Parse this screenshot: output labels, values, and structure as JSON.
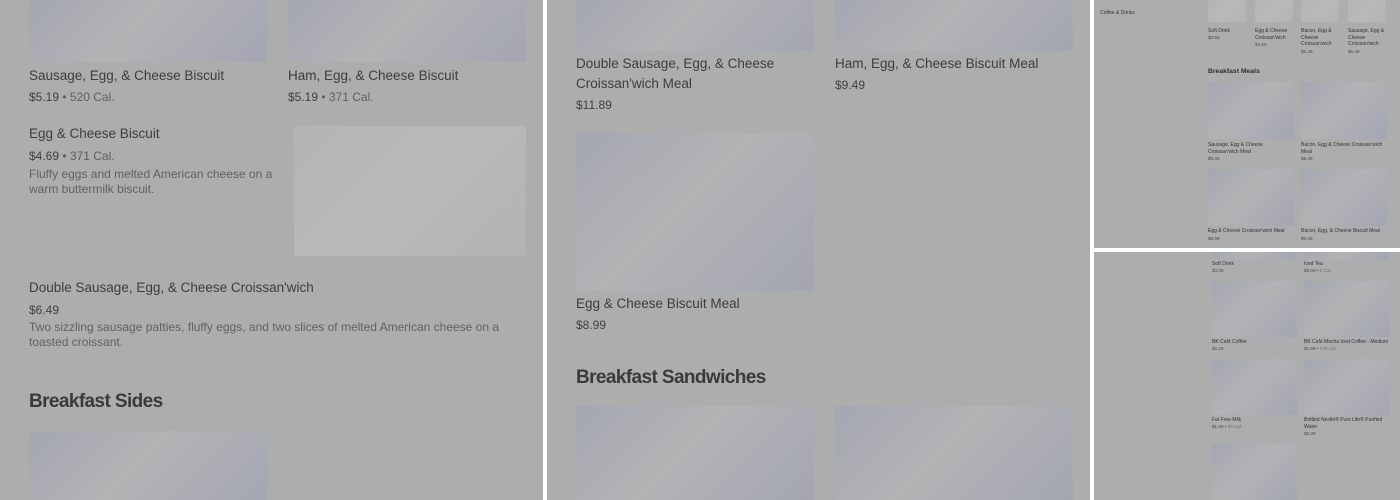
{
  "panel1": {
    "items": [
      {
        "name": "Sausage, Egg, & Cheese Biscuit",
        "price": "$5.19",
        "sep": " • ",
        "cal": "520 Cal."
      },
      {
        "name": "Ham, Egg, & Cheese Biscuit",
        "price": "$5.19",
        "sep": " • ",
        "cal": "371 Cal."
      },
      {
        "name": "Egg & Cheese Biscuit",
        "price": "$4.69",
        "sep": " • ",
        "cal": "371 Cal.",
        "desc": "Fluffy eggs and melted American cheese on a warm buttermilk biscuit."
      },
      {
        "name": "Double Sausage, Egg, & Cheese Croissan'wich",
        "price": "$6.49",
        "desc": "Two sizzling sausage patties, fluffy eggs, and two slices of melted American cheese on a toasted croissant."
      }
    ],
    "section_heading": "Breakfast Sides"
  },
  "panel2": {
    "items": [
      {
        "name": "Double Sausage, Egg, & Cheese Croissan'wich Meal",
        "price": "$11.89"
      },
      {
        "name": "Ham, Egg, & Cheese Biscuit Meal",
        "price": "$9.49"
      },
      {
        "name": "Egg & Cheese Biscuit Meal",
        "price": "$8.99"
      }
    ],
    "section_heading": "Breakfast Sandwiches"
  },
  "panel3": {
    "sidebar_item": "Coffee & Drinks",
    "top_items": [
      {
        "name": "Soft Drink",
        "price": "$3.59"
      },
      {
        "name": "Egg & Cheese Croissan'wich",
        "price": "$4.69"
      },
      {
        "name": "Bacon, Egg & Cheese Croissan'wich",
        "price": "$5.49"
      },
      {
        "name": "Sausage, Egg & Cheese Croissan'wich",
        "price": "$5.49"
      }
    ],
    "section_heading": "Breakfast Meals",
    "meals": [
      {
        "name": "Sausage, Egg & Cheese Croissan'wich Meal",
        "price": "$9.49"
      },
      {
        "name": "Bacon, Egg & Cheese Croissan'wich Meal",
        "price": "$9.49"
      },
      {
        "name": "Egg & Cheese Croissan'wich Meal",
        "price": "$8.99"
      },
      {
        "name": "Bacon, Egg, & Cheese Biscuit Meal",
        "price": "$9.49"
      }
    ]
  },
  "panel4": {
    "items": [
      {
        "name": "Soft Drink",
        "price": "$3.09"
      },
      {
        "name": "Iced Tea",
        "price": "$3.09",
        "sep": " • ",
        "cal": "0 Cal."
      },
      {
        "name": "BK Café Coffee",
        "price": "$2.29"
      },
      {
        "name": "BK Café Mocha Iced Coffee - Medium",
        "price": "$2.99",
        "sep": " • ",
        "cal": "170 Cal."
      },
      {
        "name": "Fat Free Milk",
        "price": "$1.99",
        "sep": " • ",
        "cal": "90 Cal."
      },
      {
        "name": "Bottled Nestlé® Pure Life® Purified Water",
        "price": "$2.39"
      }
    ]
  }
}
